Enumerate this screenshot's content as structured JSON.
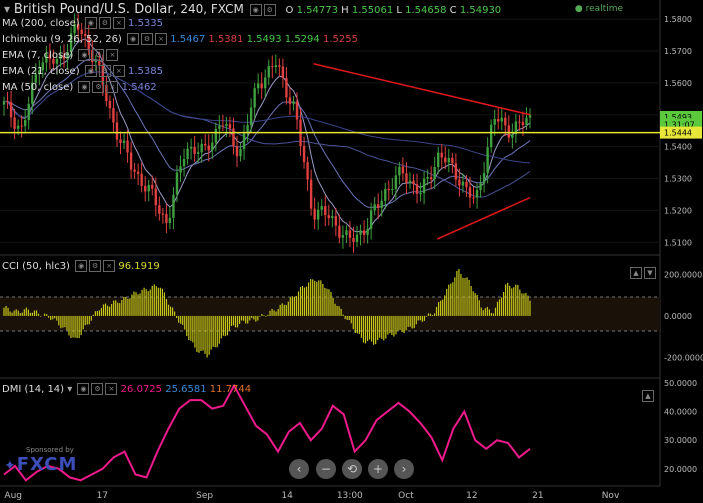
{
  "title": {
    "symbol": "British Pound/U.S. Dollar",
    "interval": "240",
    "exchange": "FXCM",
    "ohlc": [
      {
        "k": "O",
        "v": "1.54773"
      },
      {
        "k": "H",
        "v": "1.55061"
      },
      {
        "k": "L",
        "v": "1.54658"
      },
      {
        "k": "C",
        "v": "1.54930"
      }
    ],
    "realtime": "realtime"
  },
  "indicators": {
    "ma200": {
      "label": "MA (200, close)",
      "value": "1.5335"
    },
    "ichimoku": {
      "label": "Ichimoku (9, 26, 52, 26)",
      "values": [
        "1.5467",
        "1.5381",
        "1.5493",
        "1.5294",
        "1.5255"
      ]
    },
    "ema7": {
      "label": "EMA (7, close)"
    },
    "ema21": {
      "label": "EMA (21, close)",
      "value": "1.5385"
    },
    "ma50": {
      "label": "MA (50, close)",
      "value": "1.5462"
    }
  },
  "price_axis": {
    "ticks": [
      "1.5800",
      "1.5700",
      "1.5600",
      "1.5500",
      "1.5400",
      "1.5300",
      "1.5200",
      "1.5100"
    ],
    "badges": [
      {
        "text": "1.5493",
        "color": "#5cc83c"
      },
      {
        "text": "1.31:07",
        "color": "#5cc83c"
      },
      {
        "text": "1.5444",
        "color": "#e7e73a"
      }
    ]
  },
  "cci": {
    "label": "CCI (50, hlc3)",
    "value": "96.1919",
    "ticks": [
      "200.0000",
      "0.0000",
      "-200.0000"
    ]
  },
  "dmi": {
    "label": "DMI (14, 14)",
    "values": [
      "26.0725",
      "25.6581",
      "11.7744"
    ],
    "ticks": [
      "50.0000",
      "40.0000",
      "30.0000",
      "20.0000"
    ]
  },
  "time_axis": {
    "labels": [
      "Aug",
      "17",
      "Sep",
      "14",
      "13:00",
      "Oct",
      "12",
      "21",
      "Nov"
    ]
  },
  "branding": {
    "sponsor": "Sponsored by",
    "logo": "FXCM"
  },
  "nav": {
    "icons": [
      "‹",
      "−",
      "⟲",
      "+",
      "›"
    ]
  },
  "colors": {
    "up": "#3fa03f",
    "down": "#e04040",
    "trend": "#e01818",
    "horizontal": "#e6e632",
    "ema7": "#9a9ac8",
    "ema21": "#6c74b8",
    "ma50": "#4a5498",
    "ma200": "#3a4488",
    "cci": "#c8c81a",
    "dmi": "#f01a8c"
  },
  "chart_data": [
    {
      "type": "candlestick",
      "title": "British Pound/U.S. Dollar, 240, FXCM",
      "x": [
        "Aug",
        "17",
        "Sep",
        "14",
        "13:00",
        "Oct",
        "12",
        "21",
        "Nov"
      ],
      "ylim": [
        1.506,
        1.586
      ],
      "key_closes": [
        {
          "x": "Aug",
          "y": 1.553
        },
        {
          "x": "Aug",
          "y": 1.545
        },
        {
          "x": "Aug",
          "y": 1.568
        },
        {
          "x": "17",
          "y": 1.566
        },
        {
          "x": "17",
          "y": 1.578
        },
        {
          "x": "17",
          "y": 1.568
        },
        {
          "x": "Sep",
          "y": 1.548
        },
        {
          "x": "Sep",
          "y": 1.534
        },
        {
          "x": "Sep",
          "y": 1.526
        },
        {
          "x": "Sep",
          "y": 1.516
        },
        {
          "x": "Sep",
          "y": 1.54
        },
        {
          "x": "14",
          "y": 1.538
        },
        {
          "x": "14",
          "y": 1.548
        },
        {
          "x": "14",
          "y": 1.538
        },
        {
          "x": "14",
          "y": 1.56
        },
        {
          "x": "13:00",
          "y": 1.566
        },
        {
          "x": "13:00",
          "y": 1.552
        },
        {
          "x": "13:00",
          "y": 1.52
        },
        {
          "x": "Oct",
          "y": 1.518
        },
        {
          "x": "Oct",
          "y": 1.51
        },
        {
          "x": "Oct",
          "y": 1.515
        },
        {
          "x": "Oct",
          "y": 1.526
        },
        {
          "x": "12",
          "y": 1.532
        },
        {
          "x": "12",
          "y": 1.525
        },
        {
          "x": "12",
          "y": 1.538
        },
        {
          "x": "12",
          "y": 1.531
        },
        {
          "x": "12",
          "y": 1.522
        },
        {
          "x": "21",
          "y": 1.549
        },
        {
          "x": "21",
          "y": 1.545
        },
        {
          "x": "21",
          "y": 1.549
        }
      ],
      "overlays": [
        {
          "name": "resistance",
          "points": [
            [
              20.0,
              1.566
            ],
            [
              34.0,
              1.55
            ]
          ]
        },
        {
          "name": "support",
          "points": [
            [
              28.0,
              1.511
            ],
            [
              34.0,
              1.524
            ]
          ]
        },
        {
          "name": "horizontal",
          "y": 1.5444
        }
      ]
    },
    {
      "type": "bar",
      "title": "CCI (50, hlc3)",
      "ylim": [
        -300,
        280
      ],
      "values": [
        40,
        20,
        30,
        10,
        -10,
        -60,
        -120,
        -40,
        40,
        60,
        80,
        110,
        130,
        150,
        40,
        -60,
        -160,
        -190,
        -130,
        -60,
        -30,
        -20,
        10,
        40,
        80,
        140,
        180,
        140,
        40,
        -40,
        -120,
        -130,
        -100,
        -80,
        -60,
        -20,
        20,
        120,
        220,
        160,
        40,
        20,
        150,
        140,
        80
      ]
    },
    {
      "type": "line",
      "title": "DMI (14, 14)",
      "ylim": [
        14,
        51
      ],
      "values": [
        18,
        21,
        16,
        19,
        21,
        20,
        17,
        16,
        18,
        20,
        24,
        26,
        18,
        17,
        26,
        34,
        41,
        44,
        44,
        41,
        42,
        49,
        42,
        35,
        32,
        26,
        33,
        36,
        30,
        34,
        42,
        39,
        26,
        30,
        37,
        40,
        43,
        40,
        36,
        31,
        23,
        34,
        40,
        30,
        27,
        30,
        29,
        24,
        27
      ]
    }
  ]
}
